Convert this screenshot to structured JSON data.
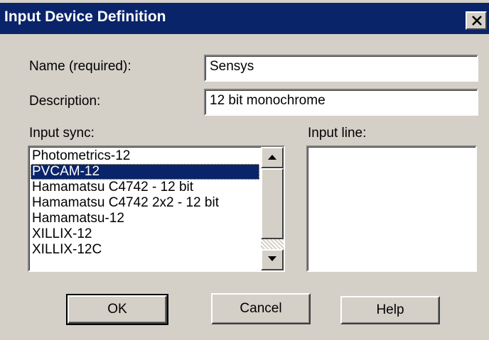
{
  "window": {
    "title": "Input Device Definition"
  },
  "form": {
    "name_label": "Name (required):",
    "name_value": "Sensys",
    "description_label": "Description:",
    "description_value": "12 bit monochrome",
    "input_sync_label": "Input sync:",
    "input_line_label": "Input line:"
  },
  "input_sync": {
    "items": [
      {
        "label": "Photometrics-12"
      },
      {
        "label": "PVCAM-12"
      },
      {
        "label": "Hamamatsu C4742 - 12 bit"
      },
      {
        "label": "Hamamatsu C4742 2x2 - 12 bit"
      },
      {
        "label": "Hamamatsu-12"
      },
      {
        "label": "XILLIX-12"
      },
      {
        "label": "XILLIX-12C"
      }
    ],
    "selected": "PVCAM-12"
  },
  "input_line": {
    "items": []
  },
  "buttons": {
    "ok": "OK",
    "cancel": "Cancel",
    "help": "Help"
  },
  "icons": {
    "close": "close-icon",
    "scroll_up": "arrow-up-icon",
    "scroll_down": "arrow-down-icon"
  },
  "colors": {
    "titlebar": "#0a246a",
    "dialog_bg": "#d4d0c8",
    "selection": "#0a246a"
  }
}
